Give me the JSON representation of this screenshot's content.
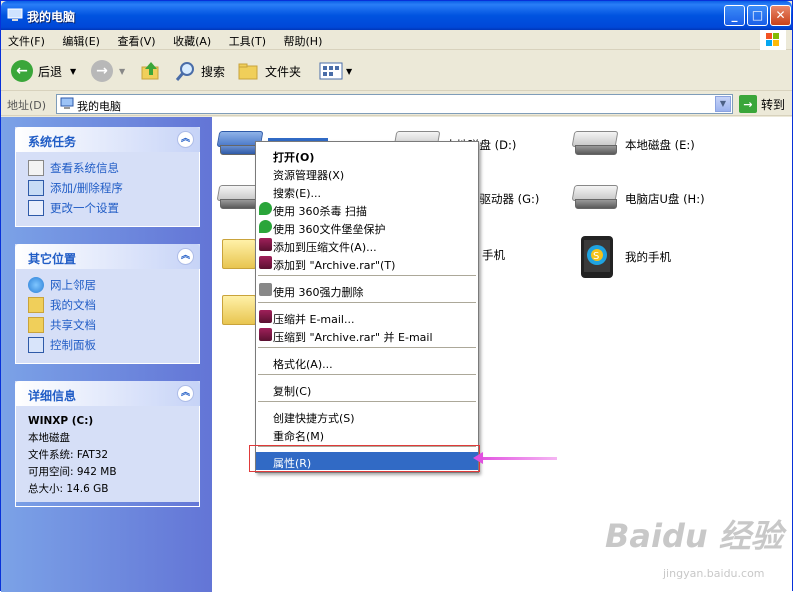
{
  "window": {
    "title": "我的电脑"
  },
  "menubar": {
    "items": [
      "文件(F)",
      "编辑(E)",
      "查看(V)",
      "收藏(A)",
      "工具(T)",
      "帮助(H)"
    ]
  },
  "toolbar": {
    "back": "后退",
    "search": "搜索",
    "folders": "文件夹"
  },
  "address": {
    "label": "地址(D)",
    "value": "我的电脑",
    "go": "转到"
  },
  "sidebar": {
    "system_tasks": {
      "title": "系统任务",
      "items": [
        "查看系统信息",
        "添加/删除程序",
        "更改一个设置"
      ]
    },
    "other_places": {
      "title": "其它位置",
      "items": [
        "网上邻居",
        "我的文档",
        "共享文档",
        "控制面板"
      ]
    },
    "details": {
      "title": "详细信息",
      "name": "WINXP (C:)",
      "type": "本地磁盘",
      "fs": "文件系统: FAT32",
      "free": "可用空间: 942 MB",
      "total": "总大小: 14.6 GB"
    }
  },
  "main": {
    "items": [
      {
        "label": "本地磁盘 (D:)"
      },
      {
        "label": "本地磁盘 (E:)"
      },
      {
        "label": "AM 驱动器 (G:)"
      },
      {
        "label": "电脑店U盘 (H:)"
      },
      {
        "label": "手机"
      },
      {
        "label": "我的手机"
      }
    ]
  },
  "context_menu": {
    "items": [
      "打开(O)",
      "资源管理器(X)",
      "搜索(E)...",
      "使用 360杀毒 扫描",
      "使用 360文件堡垒保护",
      "添加到压缩文件(A)...",
      "添加到 \"Archive.rar\"(T)",
      "使用 360强力删除",
      "压缩并 E-mail...",
      "压缩到 \"Archive.rar\" 并 E-mail",
      "格式化(A)...",
      "复制(C)",
      "创建快捷方式(S)",
      "重命名(M)",
      "属性(R)"
    ]
  },
  "watermark": {
    "brand": "Baidu 经验",
    "url": "jingyan.baidu.com"
  },
  "colors": {
    "titlebar": "#0053e0",
    "selection": "#316ac5",
    "highlight_box": "#e03a3a",
    "arrow": "#e14fe0"
  }
}
